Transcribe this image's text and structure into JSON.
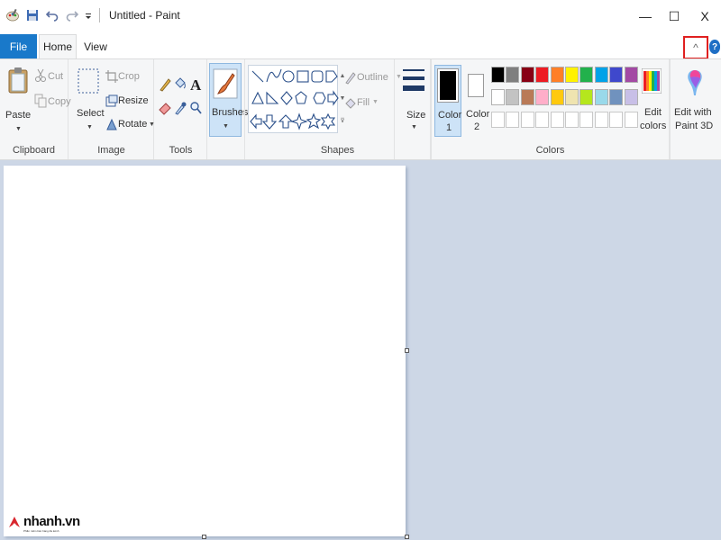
{
  "window": {
    "title": "Untitled - Paint",
    "controls": {
      "minimize": "—",
      "maximize": "☐",
      "close": "X"
    }
  },
  "tabs": [
    {
      "label": "File",
      "active": false
    },
    {
      "label": "Home",
      "active": true
    },
    {
      "label": "View",
      "active": false
    }
  ],
  "ribbon": {
    "collapse_glyph": "^",
    "help_glyph": "?",
    "clipboard": {
      "label": "Clipboard",
      "paste": "Paste",
      "cut": "Cut",
      "copy": "Copy"
    },
    "image": {
      "label": "Image",
      "select": "Select",
      "crop": "Crop",
      "resize": "Resize",
      "rotate": "Rotate"
    },
    "tools": {
      "label": "Tools",
      "text_glyph": "A"
    },
    "brushes": {
      "label": "Brushes"
    },
    "shapes": {
      "label": "Shapes",
      "outline": "Outline",
      "fill": "Fill"
    },
    "size": {
      "label": "Size"
    },
    "colors": {
      "label": "Colors",
      "color1": "Color",
      "color1_num": "1",
      "color2": "Color",
      "color2_num": "2",
      "edit_colors": [
        "Edit",
        "colors"
      ],
      "row1": [
        "#000000",
        "#7f7f7f",
        "#880015",
        "#ed1c24",
        "#ff7f27",
        "#fff200",
        "#22b14c",
        "#00a2e8",
        "#3f48cc",
        "#a349a4"
      ],
      "row2": [
        "#ffffff",
        "#c3c3c3",
        "#b97a57",
        "#ffaec9",
        "#ffc90e",
        "#efe4b0",
        "#b5e61d",
        "#99d9ea",
        "#7092be",
        "#c8bfe7"
      ],
      "accent": "#1979ca"
    },
    "paint3d": {
      "label": [
        "Edit with",
        "Paint 3D"
      ]
    }
  },
  "watermark": {
    "text": "nhanh.vn",
    "sub": "Phần mềm bán hàng đa kênh"
  }
}
